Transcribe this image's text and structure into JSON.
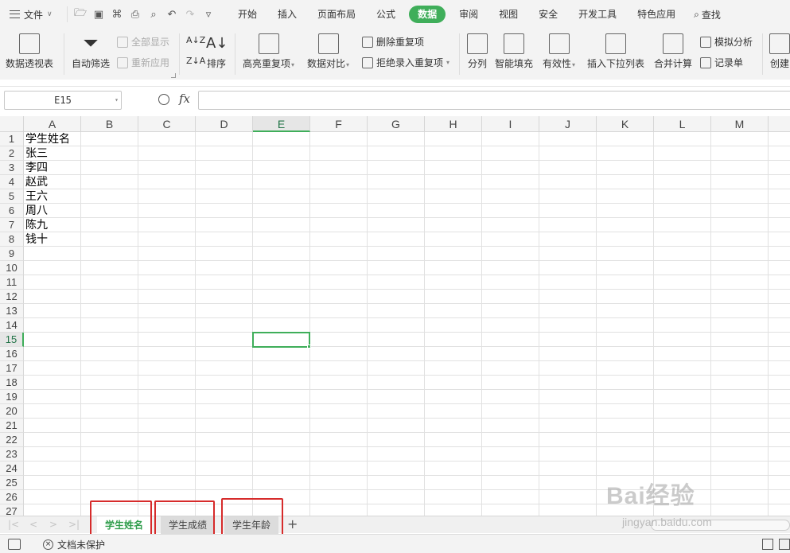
{
  "menu": {
    "file_label": "文件",
    "tabs": [
      "开始",
      "插入",
      "页面布局",
      "公式",
      "数据",
      "审阅",
      "视图",
      "安全",
      "开发工具",
      "特色应用"
    ],
    "active_tab": "数据",
    "search_label": "查找"
  },
  "ribbon": {
    "pivot": "数据透视表",
    "autofilter": "自动筛选",
    "show_all": "全部显示",
    "reapply": "重新应用",
    "sort": "排序",
    "highlight_dup": "高亮重复项",
    "compare": "数据对比",
    "delete_dup": "删除重复项",
    "reject_dup": "拒绝录入重复项",
    "split": "分列",
    "flash_fill": "智能填充",
    "validity": "有效性",
    "insert_dropdown": "插入下拉列表",
    "consolidate": "合并计算",
    "what_if": "模拟分析",
    "record_sheet": "记录单",
    "create": "创建"
  },
  "formula_bar": {
    "name_box": "E15",
    "fx": "fx",
    "value": ""
  },
  "sheet": {
    "columns": [
      "A",
      "B",
      "C",
      "D",
      "E",
      "F",
      "G",
      "H",
      "I",
      "J",
      "K",
      "L",
      "M"
    ],
    "selected_column": "E",
    "rows": [
      "1",
      "2",
      "3",
      "4",
      "5",
      "6",
      "7",
      "8",
      "9",
      "10",
      "11",
      "12",
      "13",
      "14",
      "15",
      "16",
      "17",
      "18",
      "19",
      "20",
      "21",
      "22",
      "23",
      "24",
      "25",
      "26",
      "27"
    ],
    "selected_row": "15",
    "cells_A": [
      "学生姓名",
      "张三",
      "李四",
      "赵武",
      "王六",
      "周八",
      "陈九",
      "钱十"
    ]
  },
  "sheet_tabs": [
    {
      "label": "学生姓名",
      "active": true
    },
    {
      "label": "学生成绩",
      "active": false
    },
    {
      "label": "学生年龄",
      "active": false
    }
  ],
  "status": {
    "protect_label": "文档未保护"
  },
  "watermark": {
    "brand": "Bai经验",
    "url": "jingyan.baidu.com"
  },
  "colors": {
    "accent": "#3fae5a",
    "highlight_box": "#d62b2b"
  }
}
